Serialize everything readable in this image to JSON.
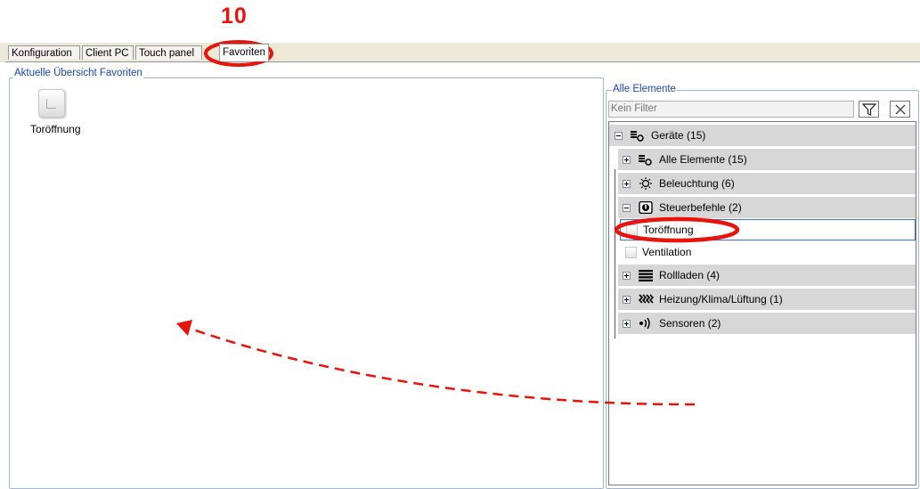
{
  "annotation": {
    "step_number": "10"
  },
  "tabs": [
    {
      "label": "Konfiguration"
    },
    {
      "label": "Client PC"
    },
    {
      "label": "Touch panel"
    },
    {
      "label": "Favoriten"
    }
  ],
  "favorites_panel": {
    "title": "Aktuelle Übersicht Favoriten",
    "items": [
      {
        "label": "Toröffnung"
      }
    ]
  },
  "elements_panel": {
    "title": "Alle Elemente",
    "filter": {
      "placeholder": "Kein Filter",
      "value": ""
    },
    "tree": {
      "root": {
        "label": "Geräte (15)",
        "icon": "devices-icon",
        "expanded": true
      },
      "groups": [
        {
          "label": "Alle Elemente (15)",
          "icon": "devices-icon",
          "expanded": false
        },
        {
          "label": "Beleuchtung (6)",
          "icon": "lightbulb-icon",
          "expanded": false
        },
        {
          "label": "Steuerbefehle (2)",
          "icon": "power-icon",
          "expanded": true,
          "children": [
            {
              "label": "Toröffnung",
              "selected": true
            },
            {
              "label": "Ventilation",
              "selected": false
            }
          ]
        },
        {
          "label": "Rollladen (4)",
          "icon": "shutter-icon",
          "expanded": false
        },
        {
          "label": "Heizung/Klima/Lüftung (1)",
          "icon": "heating-icon",
          "expanded": false
        },
        {
          "label": "Sensoren (2)",
          "icon": "sensor-icon",
          "expanded": false
        }
      ]
    }
  },
  "colors": {
    "highlight": "#e8140c",
    "group_label": "#1a44b8",
    "selection_border": "#3b6fd6"
  }
}
